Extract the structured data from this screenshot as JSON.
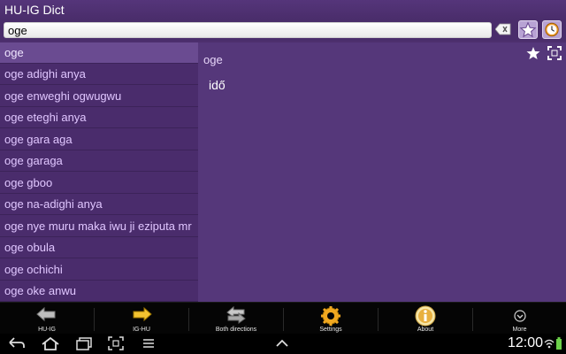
{
  "app": {
    "title": "HU-IG Dict"
  },
  "search": {
    "value": "oge"
  },
  "results": [
    "oge",
    "oge adighi anya",
    "oge enweghi ogwugwu",
    "oge eteghi anya",
    "oge gara aga",
    "oge garaga",
    "oge gboo",
    "oge na-adighi anya",
    "oge nye muru maka iwu ji eziputa mr",
    "oge obula",
    "oge ochichi",
    "oge oke anwu"
  ],
  "detail": {
    "word": "oge",
    "translation": "idő"
  },
  "toolbar": {
    "hu_ig": "HU-IG",
    "ig_hu": "IG-HU",
    "both": "Both directions",
    "settings": "Settings",
    "about": "About",
    "more": "More"
  },
  "status": {
    "time": "12:00"
  },
  "colors": {
    "background": "#4d2f6e",
    "selected": "#6a4b91",
    "text": "#e0c6ff"
  }
}
